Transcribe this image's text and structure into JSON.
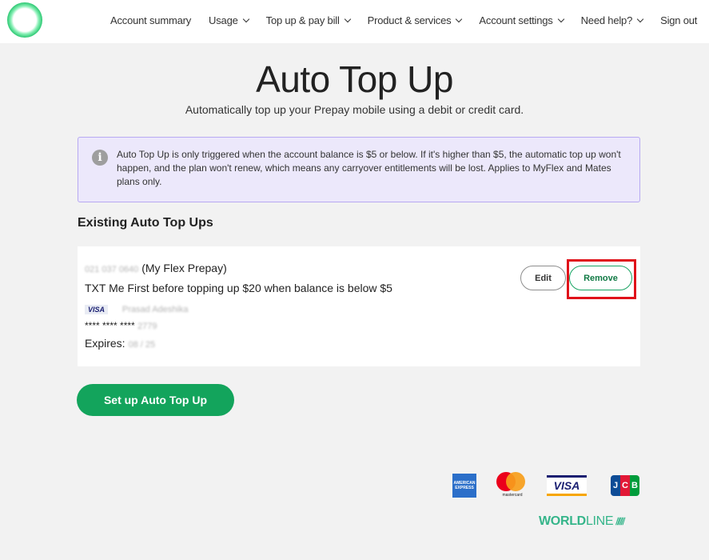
{
  "nav": {
    "items": [
      {
        "label": "Account summary",
        "chevron": false
      },
      {
        "label": "Usage",
        "chevron": true
      },
      {
        "label": "Top up & pay bill",
        "chevron": true
      },
      {
        "label": "Product & services",
        "chevron": true
      },
      {
        "label": "Account settings",
        "chevron": true
      },
      {
        "label": "Need help?",
        "chevron": true
      },
      {
        "label": "Sign out",
        "chevron": false
      }
    ]
  },
  "header": {
    "title": "Auto Top Up",
    "subtitle": "Automatically top up your Prepay mobile using a debit or credit card."
  },
  "info": {
    "icon": "info-icon",
    "text": "Auto Top Up is only triggered when the account balance is $5 or below. If it's higher than $5, the automatic top up won't happen, and the plan won't renew, which means any carryover entitlements will be lost. Applies to MyFlex and Mates plans only."
  },
  "existing": {
    "title": "Existing Auto Top Ups",
    "item": {
      "number_blurred": "021 037 0640",
      "plan": "(My Flex Prepay)",
      "rule": "TXT Me First before topping up $20 when balance is below $5",
      "card_brand": "VISA",
      "cardholder_blurred": "Prasad Adeshika",
      "card_masked": "**** **** ****",
      "card_last4_blurred": "2779",
      "expires_label": "Expires:",
      "expiry_blurred": "08 / 25",
      "edit_label": "Edit",
      "remove_label": "Remove"
    }
  },
  "setup_button": "Set up Auto Top Up",
  "payment_logos": {
    "amex": "AMERICAN EXPRESS",
    "mastercard": "mastercard",
    "visa": "VISA",
    "jcb": [
      "J",
      "C",
      "B"
    ],
    "worldline_bold": "WORLD",
    "worldline_thin": "LINE"
  },
  "colors": {
    "accent_green": "#13a45c",
    "highlight_red": "#e0121a",
    "info_bg": "#ece8fb"
  }
}
